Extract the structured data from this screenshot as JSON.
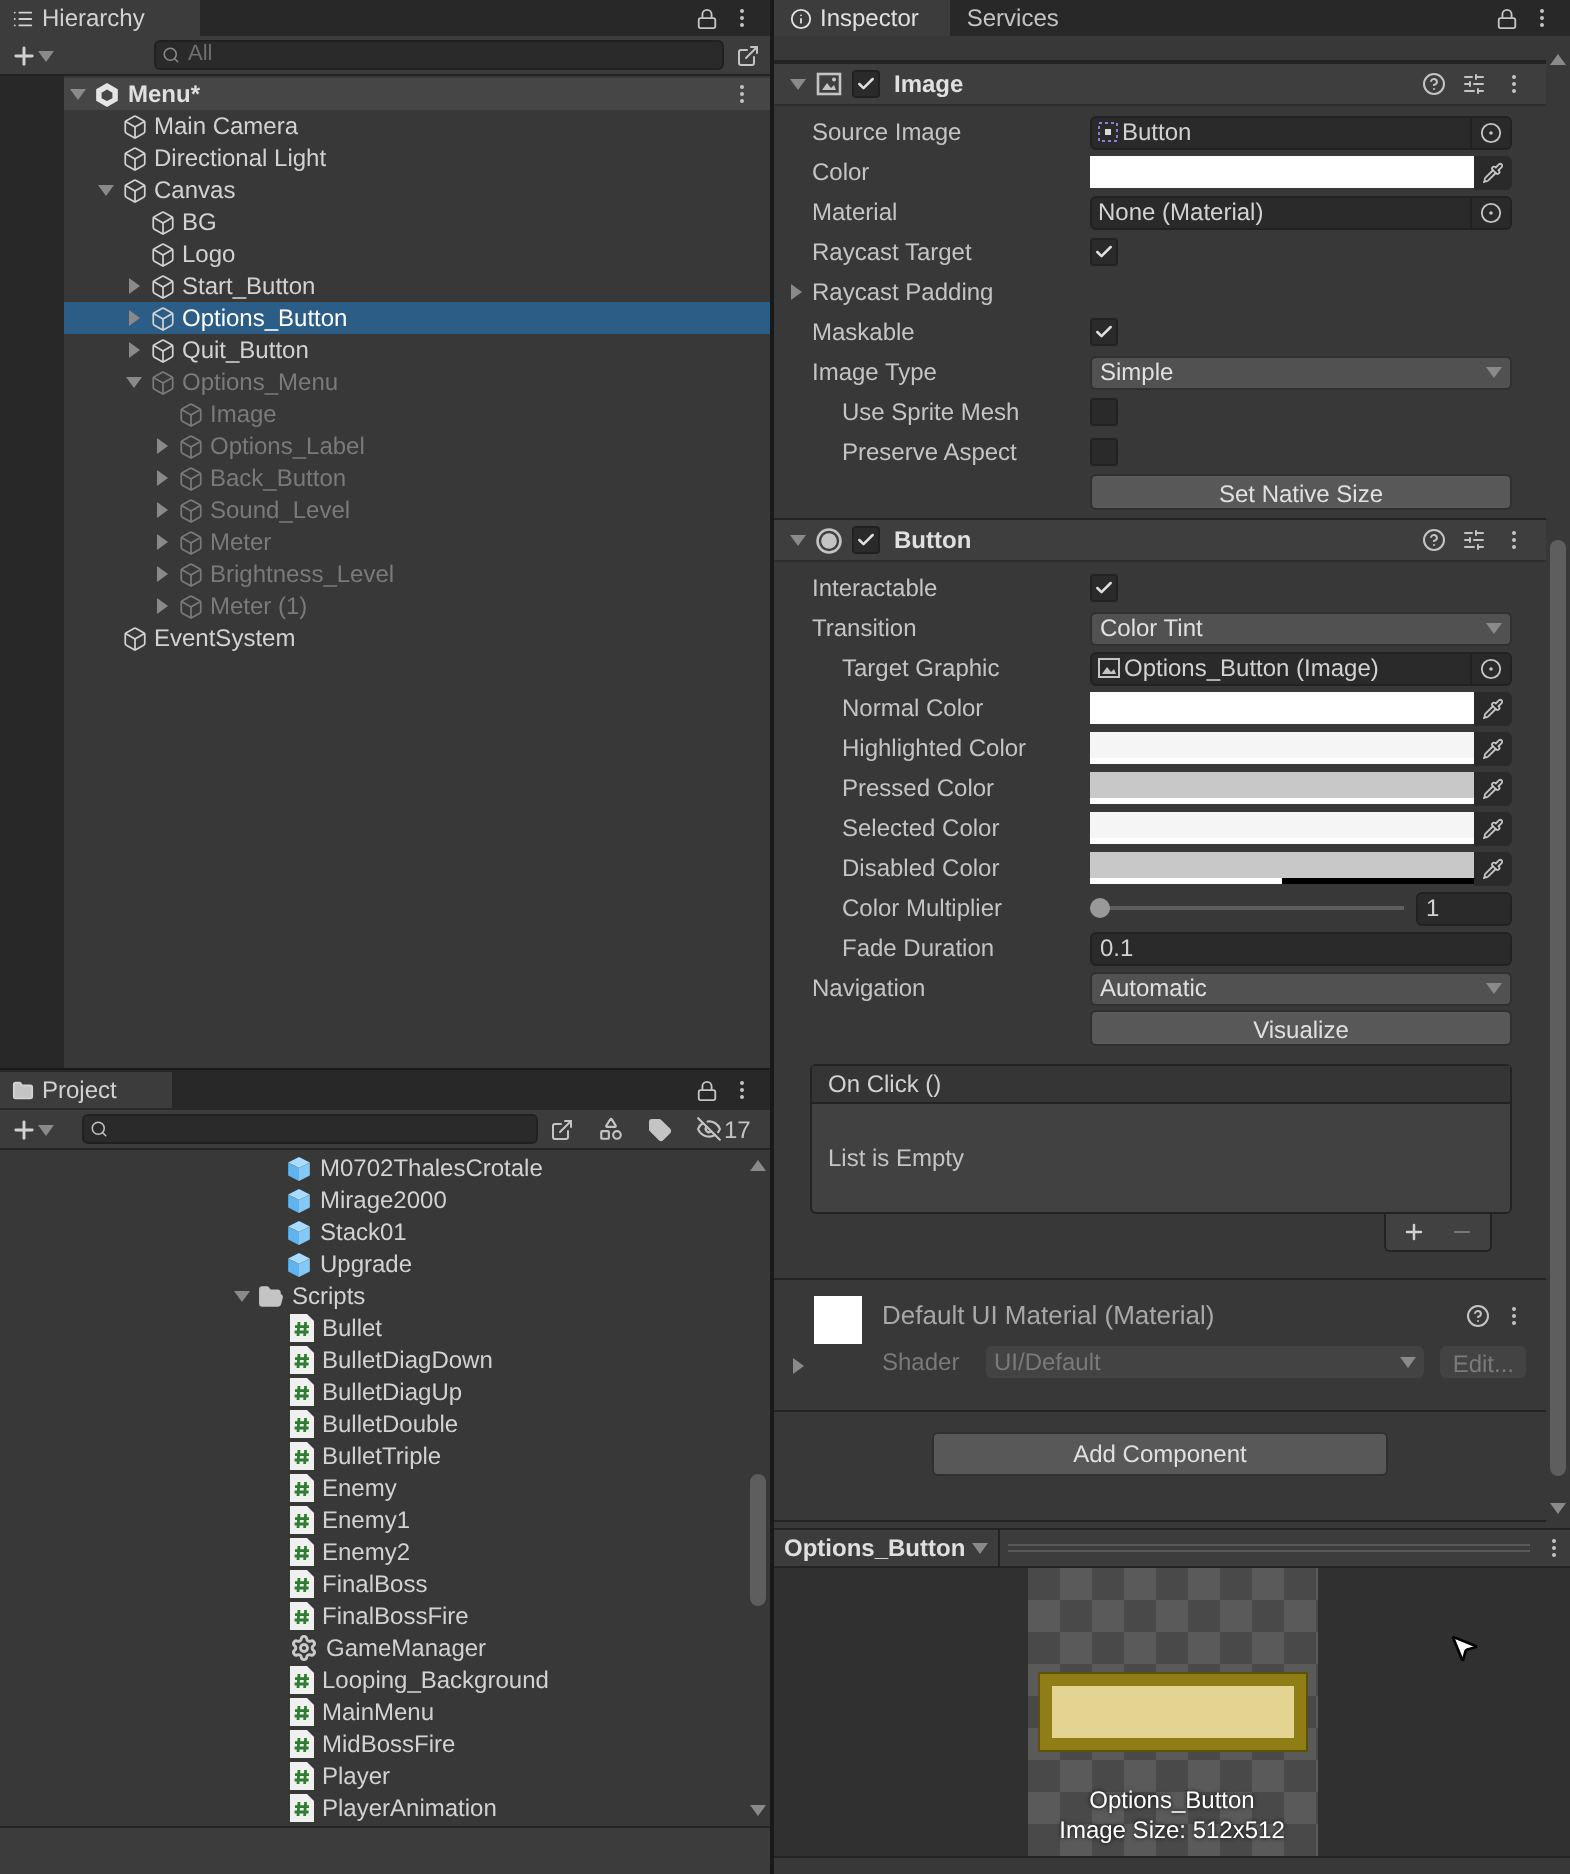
{
  "hierarchy": {
    "title": "Hierarchy",
    "search_placeholder": "All",
    "scene": {
      "label": "Menu*",
      "expanded": true,
      "children": [
        {
          "label": "Main Camera",
          "selected": false,
          "disabled": false
        },
        {
          "label": "Directional Light",
          "selected": false,
          "disabled": false
        },
        {
          "label": "Canvas",
          "expanded": true,
          "selected": false,
          "disabled": false,
          "children": [
            {
              "label": "BG",
              "selected": false,
              "disabled": false
            },
            {
              "label": "Logo",
              "selected": false,
              "disabled": false
            },
            {
              "label": "Start_Button",
              "expanded": false,
              "selected": false,
              "disabled": false
            },
            {
              "label": "Options_Button",
              "expanded": false,
              "selected": true,
              "disabled": false
            },
            {
              "label": "Quit_Button",
              "expanded": false,
              "selected": false,
              "disabled": false
            },
            {
              "label": "Options_Menu",
              "expanded": true,
              "selected": false,
              "disabled": true,
              "children": [
                {
                  "label": "Image",
                  "selected": false,
                  "disabled": true
                },
                {
                  "label": "Options_Label",
                  "expanded": false,
                  "selected": false,
                  "disabled": true
                },
                {
                  "label": "Back_Button",
                  "expanded": false,
                  "selected": false,
                  "disabled": true
                },
                {
                  "label": "Sound_Level",
                  "expanded": false,
                  "selected": false,
                  "disabled": true
                },
                {
                  "label": "Meter",
                  "expanded": false,
                  "selected": false,
                  "disabled": true
                },
                {
                  "label": "Brightness_Level",
                  "expanded": false,
                  "selected": false,
                  "disabled": true
                },
                {
                  "label": "Meter (1)",
                  "expanded": false,
                  "selected": false,
                  "disabled": true
                }
              ]
            }
          ]
        },
        {
          "label": "EventSystem",
          "selected": false,
          "disabled": false
        }
      ]
    }
  },
  "project": {
    "title": "Project",
    "hidden_count": "17",
    "assets": [
      {
        "kind": "prefab",
        "label": "M0702ThalesCrotale"
      },
      {
        "kind": "prefab",
        "label": "Mirage2000"
      },
      {
        "kind": "prefab",
        "label": "Stack01"
      },
      {
        "kind": "prefab",
        "label": "Upgrade"
      }
    ],
    "folder": {
      "label": "Scripts",
      "expanded": true,
      "children": [
        {
          "kind": "script",
          "label": "Bullet"
        },
        {
          "kind": "script",
          "label": "BulletDiagDown"
        },
        {
          "kind": "script",
          "label": "BulletDiagUp"
        },
        {
          "kind": "script",
          "label": "BulletDouble"
        },
        {
          "kind": "script",
          "label": "BulletTriple"
        },
        {
          "kind": "script",
          "label": "Enemy"
        },
        {
          "kind": "script",
          "label": "Enemy1"
        },
        {
          "kind": "script",
          "label": "Enemy2"
        },
        {
          "kind": "script",
          "label": "FinalBoss"
        },
        {
          "kind": "script",
          "label": "FinalBossFire"
        },
        {
          "kind": "manager",
          "label": "GameManager"
        },
        {
          "kind": "script",
          "label": "Looping_Background"
        },
        {
          "kind": "script",
          "label": "MainMenu"
        },
        {
          "kind": "script",
          "label": "MidBossFire"
        },
        {
          "kind": "script",
          "label": "Player"
        },
        {
          "kind": "script",
          "label": "PlayerAnimation"
        }
      ]
    }
  },
  "inspector": {
    "tabs": [
      {
        "label": "Inspector",
        "selected": true
      },
      {
        "label": "Services",
        "selected": false
      }
    ],
    "components": [
      {
        "kind": "image",
        "name": "Image",
        "enabled": true,
        "expanded": true,
        "properties": [
          {
            "kind": "sprite_object",
            "label": "Source Image",
            "value": "Button"
          },
          {
            "kind": "color",
            "label": "Color",
            "color": "#ffffff",
            "level": 1
          },
          {
            "kind": "object",
            "label": "Material",
            "value": "None (Material)"
          },
          {
            "kind": "checkbox",
            "label": "Raycast Target",
            "checked": true
          },
          {
            "kind": "foldout",
            "label": "Raycast Padding",
            "expanded": false
          },
          {
            "kind": "checkbox",
            "label": "Maskable",
            "checked": true
          },
          {
            "kind": "dropdown",
            "label": "Image Type",
            "value": "Simple",
            "children": [
              {
                "kind": "checkbox",
                "label": "Use Sprite Mesh",
                "checked": false
              },
              {
                "kind": "checkbox",
                "label": "Preserve Aspect",
                "checked": false
              }
            ]
          },
          {
            "kind": "button",
            "label": "Set Native Size"
          }
        ]
      },
      {
        "kind": "button",
        "name": "Button",
        "enabled": true,
        "expanded": true,
        "properties": [
          {
            "kind": "checkbox",
            "label": "Interactable",
            "checked": true
          },
          {
            "kind": "dropdown",
            "label": "Transition",
            "value": "Color Tint",
            "children": [
              {
                "kind": "image_object",
                "label": "Target Graphic",
                "value": "Options_Button (Image)"
              },
              {
                "kind": "color",
                "label": "Normal Color",
                "color": "#ffffff",
                "level": 1
              },
              {
                "kind": "color",
                "label": "Highlighted Color",
                "color": "#f5f5f5",
                "level": 1
              },
              {
                "kind": "color",
                "label": "Pressed Color",
                "color": "#c8c8c8",
                "level": 1
              },
              {
                "kind": "color",
                "label": "Selected Color",
                "color": "#f5f5f5",
                "level": 1
              },
              {
                "kind": "color",
                "label": "Disabled Color",
                "color": "#c8c8c8",
                "level": 0.5
              },
              {
                "kind": "slider",
                "label": "Color Multiplier",
                "level": 0,
                "value": "1"
              },
              {
                "kind": "text",
                "label": "Fade Duration",
                "value": "0.1"
              }
            ]
          },
          {
            "kind": "dropdown",
            "label": "Navigation",
            "value": "Automatic"
          },
          {
            "kind": "button",
            "label": "Visualize"
          }
        ],
        "event": {
          "title": "On Click ()",
          "empty_text": "List is Empty"
        }
      }
    ],
    "material": {
      "name": "Default UI Material (Material)",
      "shader_label": "Shader",
      "shader": "UI/Default",
      "edit_label": "Edit..."
    },
    "add_component": "Add Component",
    "preview": {
      "title": "Options_Button",
      "caption": "Options_Button",
      "size": "Image Size: 512x512"
    }
  }
}
